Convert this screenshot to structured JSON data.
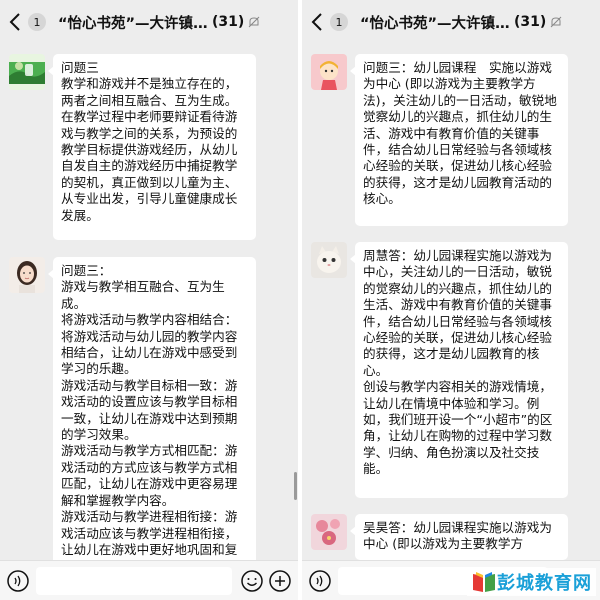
{
  "left_chat": {
    "title": "“怡心书苑”—大许镇中…",
    "member_count": "(31)",
    "unread": "1",
    "messages": [
      {
        "avatar": "avatar-green-scenery",
        "lines": [
          "问题三",
          "教学和游戏并不是独立存在的，两者之间相互融合、互为生成。",
          "在教学过程中老师要辩证看待游戏与教学之间的关系，为预设的教学目标提供游戏经历，从幼儿自发自主的游戏经历中捕捉教学的契机，真正做到以儿童为主、从专业出发，引导儿童健康成长发展。"
        ]
      },
      {
        "avatar": "avatar-girl-portrait",
        "lines": [
          "问题三：",
          "游戏与教学相互融合、互为生成。",
          "将游戏活动与教学内容相结合：将游戏活动与幼儿园的教学内容相结合，让幼儿在游戏中感受到学习的乐趣。",
          "游戏活动与教学目标相一致：游戏活动的设置应该与教学目标相一致，让幼儿在游戏中达到预期的学习效果。",
          "游戏活动与教学方式相匹配：游戏活动的方式应该与教学方式相匹配，让幼儿在游戏中更容易理解和掌握教学内容。",
          "游戏活动与教学进程相衔接：游戏活动应该与教学进程相衔接，让幼儿在游戏中更好地巩固和复"
        ]
      }
    ]
  },
  "right_chat": {
    "title": "“怡心书苑”—大许镇中…",
    "member_count": "(31)",
    "unread": "1",
    "messages": [
      {
        "avatar": "avatar-cartoon-girl",
        "lines": [
          "问题三：幼儿园课程　实施以游戏为中心 (即以游戏为主要教学方法)，关注幼儿的一日活动，敏锐地觉察幼儿的兴趣点，抓住幼儿的生活、游戏中有教育价值的关键事件，结合幼儿日常经验与各领域核心经验的关联，促进幼儿核心经验的获得，这才是幼儿园教育活动的核心。"
        ]
      },
      {
        "avatar": "avatar-white-cat",
        "lines": [
          "周慧答：幼儿园课程实施以游戏为中心，关注幼儿的一日活动，敏锐的觉察幼儿的兴趣点，抓住幼儿的生活、游戏中有教育价值的关键事件，结合幼儿日常经验与各领域核心经验的关联，促进幼儿核心经验的获得，这才是幼儿园教育的核心。",
          "创设与教学内容相关的游戏情境，让幼儿在情境中体验和学习。例如，我们班开设一个“小超市”的区角，让幼儿在购物的过程中学习数学、归纳、角色扮演以及社交技能。"
        ]
      },
      {
        "avatar": "avatar-pink-flowers",
        "lines": [
          "吴昊答：幼儿园课程实施以游戏为中心 (即以游戏为主要教学方"
        ]
      }
    ]
  },
  "icons": {
    "back": "chevron-left-icon",
    "mute": "bell-off-icon",
    "voice": "voice-icon",
    "emoji": "emoji-icon",
    "plus": "plus-circle-icon"
  },
  "watermark": {
    "text": "彭城教育网"
  },
  "colors": {
    "chat_background": "#ededed",
    "bubble": "#ffffff",
    "watermark": "#1aa0d8"
  }
}
